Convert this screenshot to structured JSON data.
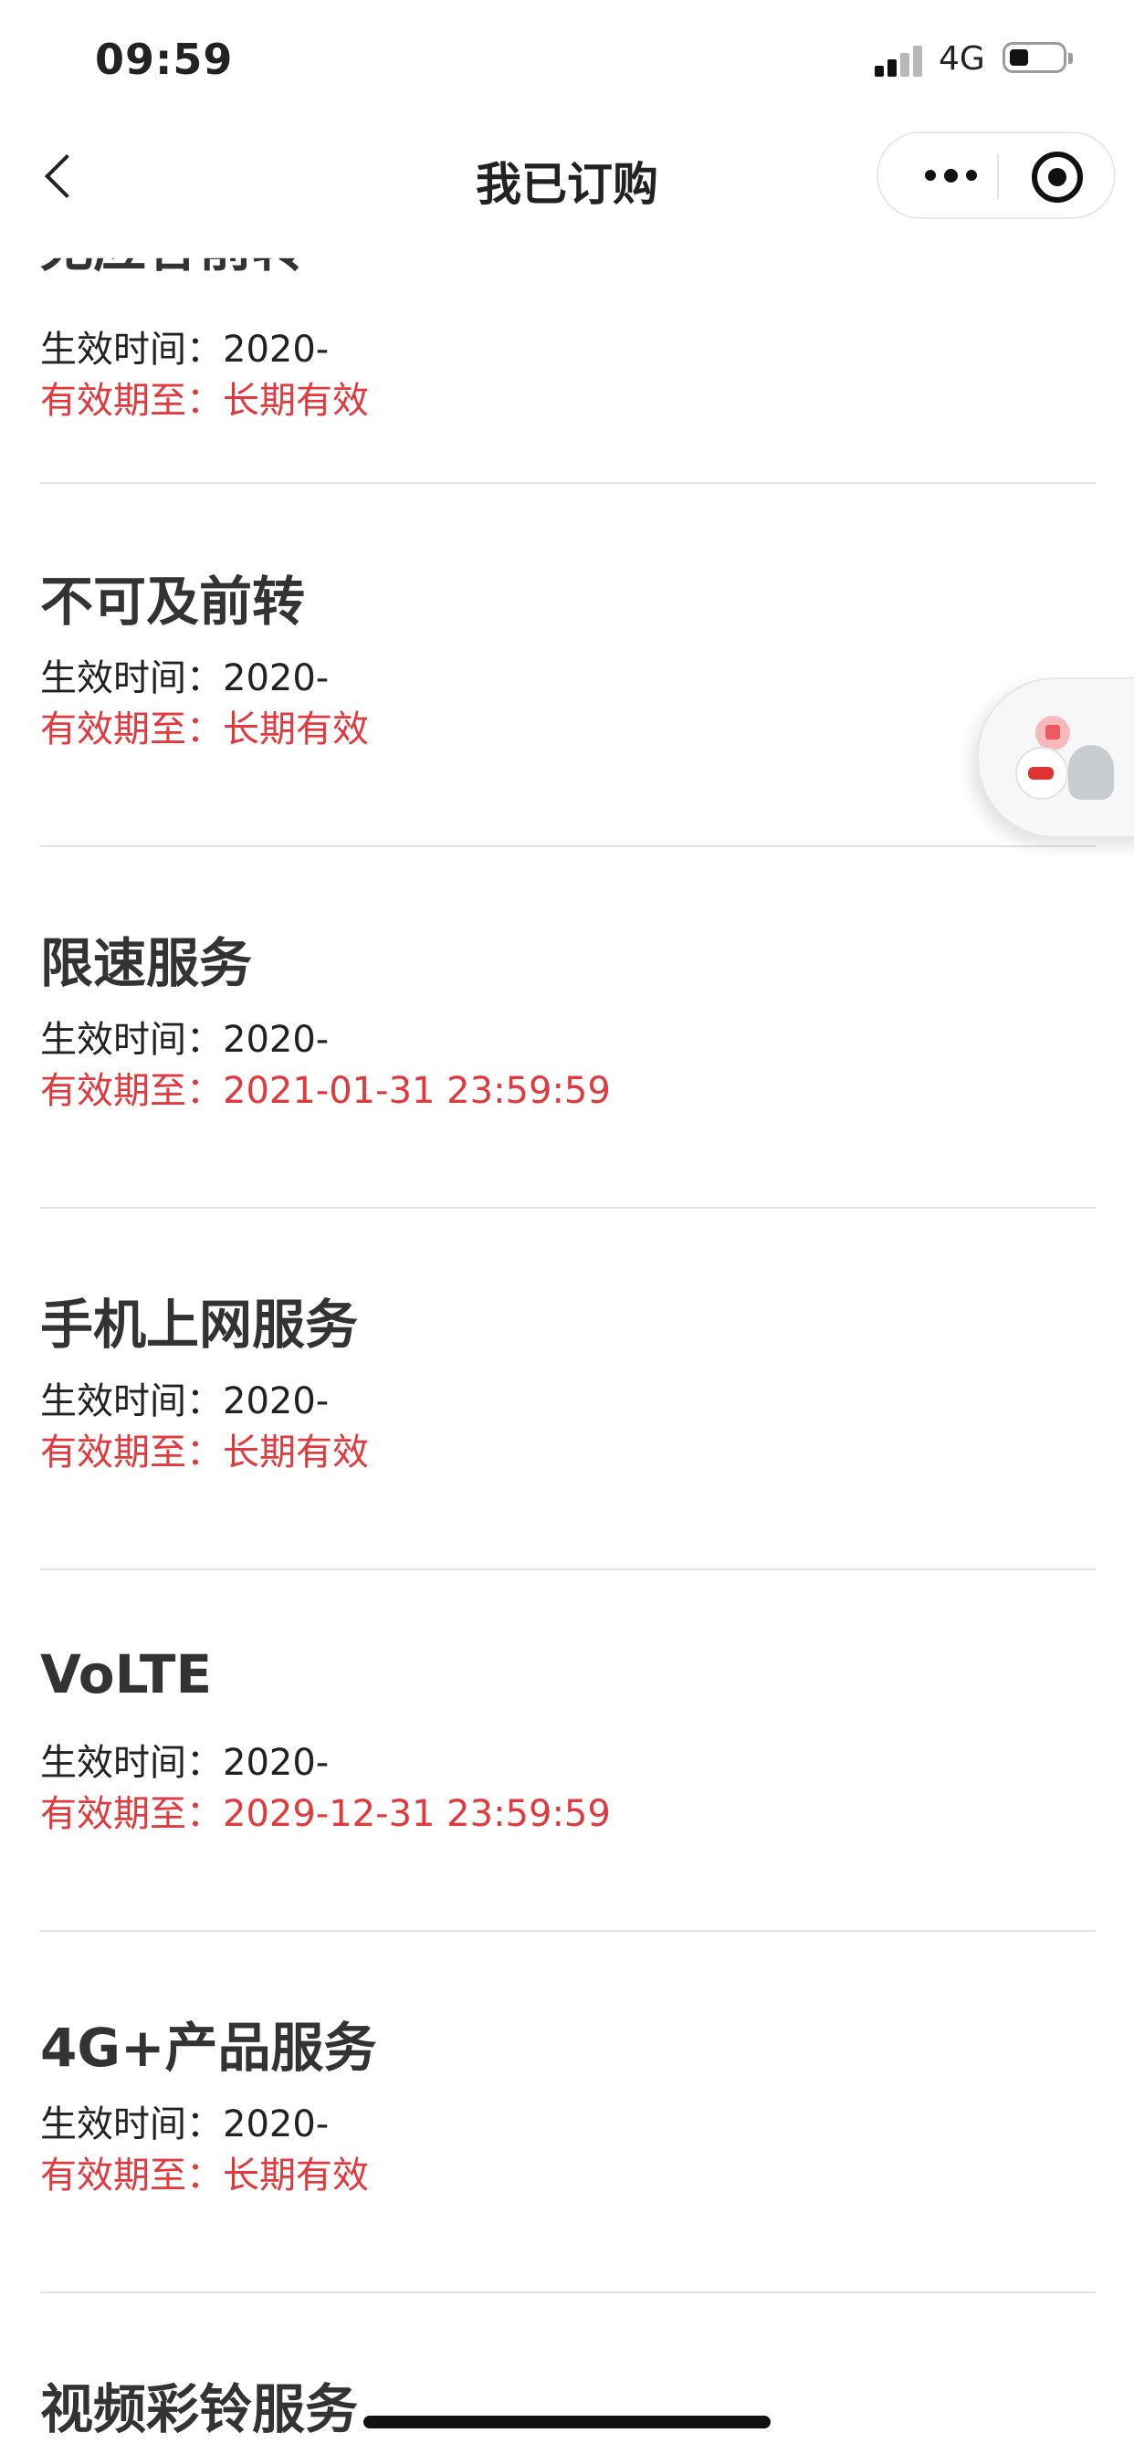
{
  "status_bar": {
    "time": "09:59",
    "network": "4G",
    "battery_level": 0.35
  },
  "nav": {
    "title": "我已订购"
  },
  "items": [
    {
      "title": "无应答前转",
      "start_label": "生效时间：",
      "start_value": "2020-",
      "expire_label": "有效期至：",
      "expire_value": "长期有效"
    },
    {
      "title": "不可及前转",
      "start_label": "生效时间：",
      "start_value": "2020-",
      "expire_label": "有效期至：",
      "expire_value": "长期有效"
    },
    {
      "title": "限速服务",
      "start_label": "生效时间：",
      "start_value": "2020-",
      "expire_label": "有效期至：",
      "expire_value": "2021-01-31 23:59:59"
    },
    {
      "title": "手机上网服务",
      "start_label": "生效时间：",
      "start_value": "2020-",
      "expire_label": "有效期至：",
      "expire_value": "长期有效"
    },
    {
      "title": "VoLTE",
      "start_label": "生效时间：",
      "start_value": "2020-",
      "expire_label": "有效期至：",
      "expire_value": "2029-12-31 23:59:59"
    },
    {
      "title": "4G+产品服务",
      "start_label": "生效时间：",
      "start_value": "2020-",
      "expire_label": "有效期至：",
      "expire_value": "长期有效"
    },
    {
      "title": "视频彩铃服务"
    }
  ],
  "icons": {
    "back": "chevron-left-icon",
    "more": "more-dots-icon",
    "close": "target-icon",
    "float": "shop-bag-icon"
  },
  "colors": {
    "expire_red": "#e03a3e",
    "text": "#222222",
    "divider": "#e2e2e2"
  }
}
